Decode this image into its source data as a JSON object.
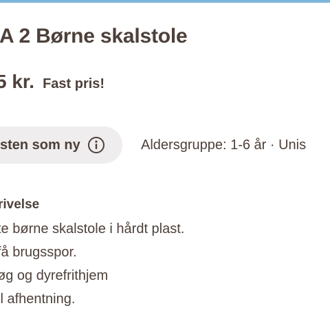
{
  "listing": {
    "title": "A 2 Børne skalstole",
    "price": "5 kr.",
    "price_note": "Fast pris!"
  },
  "details": {
    "condition_label": "sten som ny",
    "age_text": "Aldersgruppe: 1-6 år · Unis"
  },
  "description": {
    "heading": "rivelse",
    "lines": [
      "te børne skalstole i hårdt plast.",
      "få brugsspor.",
      "øg og dyrefrithjem",
      "il afhentning."
    ]
  },
  "colors": {
    "accent_bar": "#7eb6da",
    "text": "#4d403a",
    "chip_background": "#efeded"
  },
  "icons": {
    "condition_info": "info-icon"
  }
}
